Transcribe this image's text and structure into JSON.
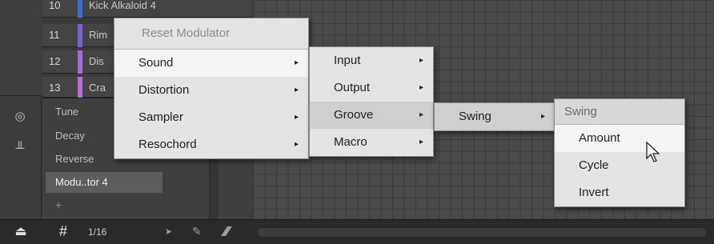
{
  "tracks": [
    {
      "num": "10",
      "name": "Kick Alkaloid 4",
      "color": "#3d6fd1"
    },
    {
      "num": "11",
      "name": "Rim",
      "color": "#7b63d6"
    },
    {
      "num": "12",
      "name": "Dis",
      "color": "#a86ad8"
    },
    {
      "num": "13",
      "name": "Cra",
      "color": "#c26ad8"
    }
  ],
  "modulation": {
    "items": [
      "Tune",
      "Decay",
      "Reverse",
      "Modu..tor 4"
    ],
    "active_index": 3,
    "add_label": "+"
  },
  "bottom_bar": {
    "hash_symbol": "#",
    "grid_value": "1/16"
  },
  "menu_main": {
    "reset": "Reset Modulator",
    "items": [
      "Sound",
      "Distortion",
      "Sampler",
      "Resochord"
    ]
  },
  "menu_sound": {
    "items": [
      "Input",
      "Output",
      "Groove",
      "Macro"
    ]
  },
  "menu_groove": {
    "items": [
      "Swing"
    ]
  },
  "menu_swing": {
    "header": "Swing",
    "items": [
      "Amount",
      "Cycle",
      "Invert"
    ]
  },
  "icons": {
    "arrow": "▸",
    "eject": "⏏",
    "pointer": "➤",
    "pen": "✎"
  },
  "colors": {
    "menu_bg": "#e4e4e4",
    "menu_hl": "#cfcfcf",
    "app_bg": "#3a3a3a"
  }
}
